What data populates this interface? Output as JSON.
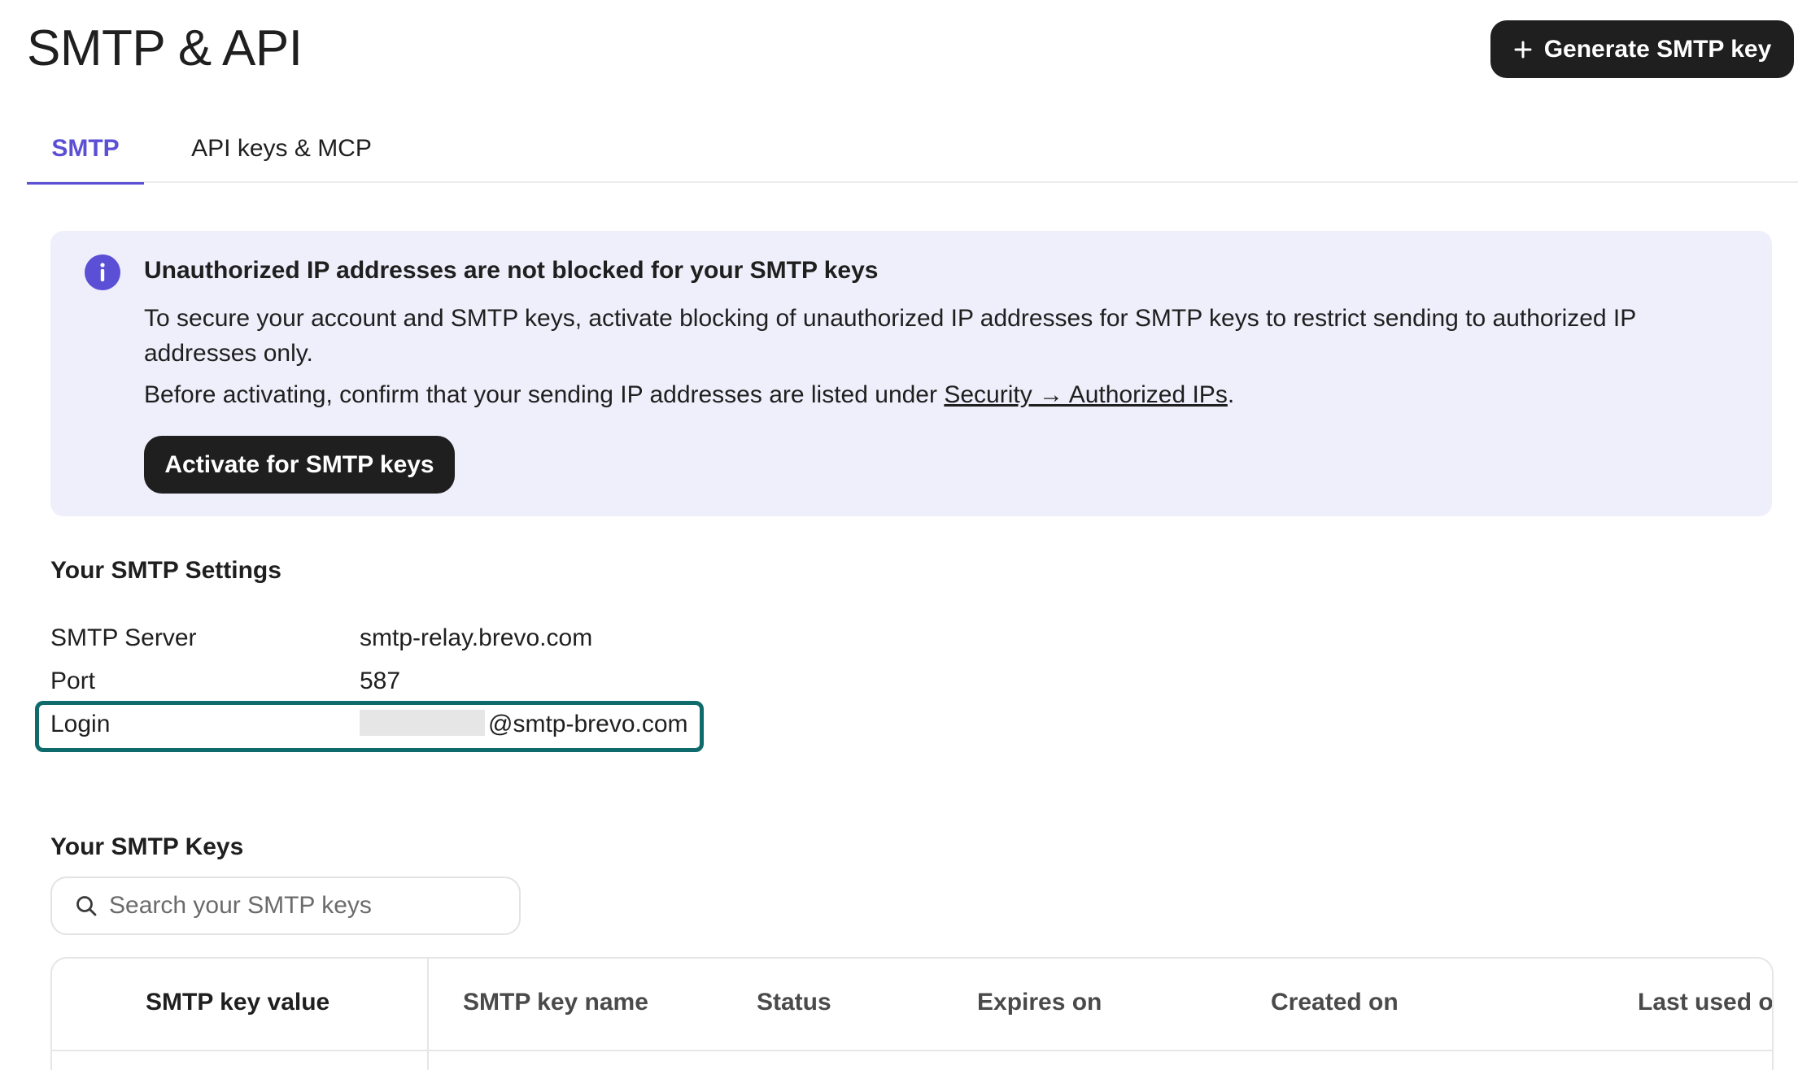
{
  "page": {
    "title": "SMTP & API"
  },
  "header": {
    "generate_button_label": "Generate SMTP key",
    "generate_button_icon": "plus-icon"
  },
  "tabs": [
    {
      "label": "SMTP",
      "active": true
    },
    {
      "label": "API keys & MCP",
      "active": false
    }
  ],
  "alert": {
    "icon": "info-icon",
    "title": "Unauthorized IP addresses are not blocked for your SMTP keys",
    "body": "To secure your account and SMTP keys, activate blocking of unauthorized IP addresses for SMTP keys to restrict sending to authorized IP addresses only.",
    "body2_prefix": "Before activating, confirm that your sending IP addresses are listed under ",
    "body2_link": "Security → Authorized IPs",
    "body2_suffix": ".",
    "button_label": "Activate for SMTP keys",
    "accent_color": "#5b4fd6"
  },
  "smtp_settings": {
    "title": "Your SMTP Settings",
    "server_label": "SMTP Server",
    "server_value": "smtp-relay.brevo.com",
    "port_label": "Port",
    "port_value": "587",
    "login_label": "Login",
    "login_value_suffix": "@smtp-brevo.com",
    "highlight_color": "#0f6b6b"
  },
  "smtp_keys": {
    "title": "Your SMTP Keys",
    "search_placeholder": "Search your SMTP keys",
    "columns": [
      "SMTP key value",
      "SMTP key name",
      "Status",
      "Expires on",
      "Created on",
      "Last used on"
    ]
  }
}
